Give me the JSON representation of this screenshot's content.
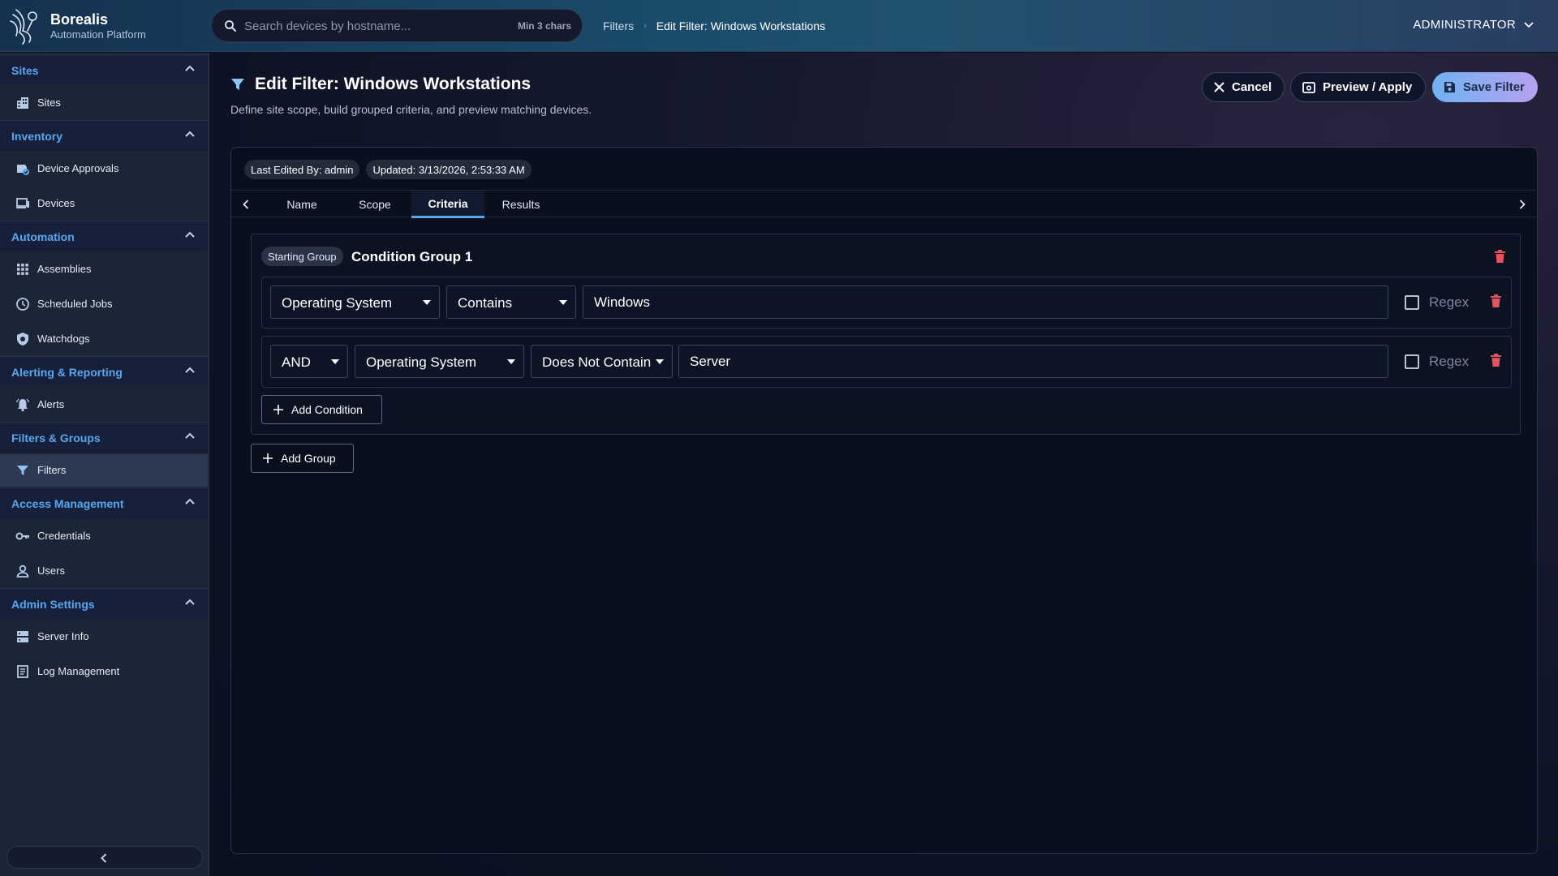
{
  "colors": {
    "accent": "#5aa7f0",
    "danger": "#e5535f",
    "save_gradient_start": "#6fb2f2",
    "save_gradient_end": "#b6a1f0"
  },
  "brand": {
    "name": "Borealis",
    "subtitle": "Automation Platform",
    "logo_icon": "borealis-logo-icon"
  },
  "search": {
    "placeholder": "Search devices by hostname...",
    "value": "",
    "hint": "Min 3 chars",
    "icon": "search-icon"
  },
  "breadcrumb": {
    "items": [
      "Filters",
      "Edit Filter: Windows Workstations"
    ]
  },
  "user": {
    "label": "ADMINISTRATOR"
  },
  "sidebar": {
    "sections": [
      {
        "label": "Sites",
        "items": [
          {
            "label": "Sites",
            "icon": "building-icon"
          }
        ]
      },
      {
        "label": "Inventory",
        "items": [
          {
            "label": "Device Approvals",
            "icon": "device-approval-icon"
          },
          {
            "label": "Devices",
            "icon": "devices-icon"
          }
        ]
      },
      {
        "label": "Automation",
        "items": [
          {
            "label": "Assemblies",
            "icon": "grid-icon"
          },
          {
            "label": "Scheduled Jobs",
            "icon": "clock-icon"
          },
          {
            "label": "Watchdogs",
            "icon": "shield-icon"
          }
        ]
      },
      {
        "label": "Alerting & Reporting",
        "items": [
          {
            "label": "Alerts",
            "icon": "bell-icon"
          }
        ]
      },
      {
        "label": "Filters & Groups",
        "items": [
          {
            "label": "Filters",
            "icon": "filter-icon",
            "active": true
          }
        ]
      },
      {
        "label": "Access Management",
        "items": [
          {
            "label": "Credentials",
            "icon": "key-icon"
          },
          {
            "label": "Users",
            "icon": "user-icon"
          }
        ]
      },
      {
        "label": "Admin Settings",
        "items": [
          {
            "label": "Server Info",
            "icon": "server-icon"
          },
          {
            "label": "Log Management",
            "icon": "log-icon"
          }
        ]
      }
    ]
  },
  "page": {
    "title": "Edit Filter: Windows Workstations",
    "subtitle": "Define site scope, build grouped criteria, and preview matching devices.",
    "actions": {
      "cancel": "Cancel",
      "preview": "Preview / Apply",
      "save": "Save Filter"
    },
    "meta": {
      "last_edited": "Last Edited By: admin",
      "updated": "Updated: 3/13/2026, 2:53:33 AM"
    },
    "tabs": [
      "Name",
      "Scope",
      "Criteria",
      "Results"
    ],
    "active_tab": "Criteria"
  },
  "criteria": {
    "group": {
      "badge": "Starting Group",
      "title": "Condition Group 1",
      "conditions": [
        {
          "field": "Operating System",
          "operator": "Contains",
          "value": "Windows",
          "regex_label": "Regex",
          "regex": false
        },
        {
          "joiner": "AND",
          "field": "Operating System",
          "operator": "Does Not Contain",
          "value": "Server",
          "regex_label": "Regex",
          "regex": false
        }
      ],
      "add_condition_label": "Add Condition"
    },
    "add_group_label": "Add Group"
  }
}
